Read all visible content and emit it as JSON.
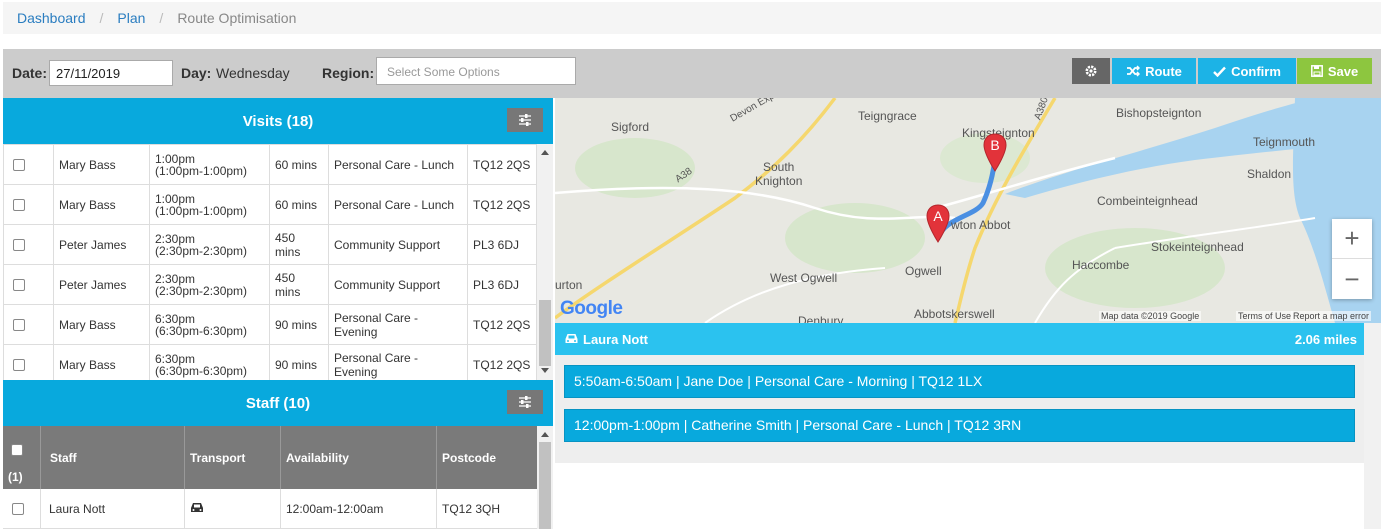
{
  "breadcrumb": {
    "items": [
      "Dashboard",
      "Plan"
    ],
    "current": "Route Optimisation",
    "separator": "/"
  },
  "filters": {
    "date_label": "Date:",
    "date_value": "27/11/2019",
    "day_label": "Day:",
    "day_value": "Wednesday",
    "region_label": "Region:",
    "region_placeholder": "Select Some Options"
  },
  "toolbar": {
    "route_label": "Route",
    "confirm_label": "Confirm",
    "save_label": "Save"
  },
  "visits": {
    "title": "Visits (18)",
    "rows": [
      {
        "name": "Mary Bass",
        "time": "1:00pm",
        "range": "(1:00pm-1:00pm)",
        "duration": "60 mins",
        "type": "Personal Care - Lunch",
        "postcode": "TQ12 2QS"
      },
      {
        "name": "Mary Bass",
        "time": "1:00pm",
        "range": "(1:00pm-1:00pm)",
        "duration": "60 mins",
        "type": "Personal Care - Lunch",
        "postcode": "TQ12 2QS"
      },
      {
        "name": "Peter James",
        "time": "2:30pm",
        "range": "(2:30pm-2:30pm)",
        "duration": "450 mins",
        "type": "Community Support",
        "postcode": "PL3 6DJ"
      },
      {
        "name": "Peter James",
        "time": "2:30pm",
        "range": "(2:30pm-2:30pm)",
        "duration": "450 mins",
        "type": "Community Support",
        "postcode": "PL3 6DJ"
      },
      {
        "name": "Mary Bass",
        "time": "6:30pm",
        "range": "(6:30pm-6:30pm)",
        "duration": "90 mins",
        "type": "Personal Care - Evening",
        "postcode": "TQ12 2QS"
      },
      {
        "name": "Mary Bass",
        "time": "6:30pm",
        "range": "(6:30pm-6:30pm)",
        "duration": "90 mins",
        "type": "Personal Care - Evening",
        "postcode": "TQ12 2QS"
      }
    ]
  },
  "staff": {
    "title": "Staff (10)",
    "selected_count": "(1)",
    "columns": {
      "staff": "Staff",
      "transport": "Transport",
      "availability": "Availability",
      "postcode": "Postcode"
    },
    "rows": [
      {
        "name": "Laura Nott",
        "transport_icon": "car-icon",
        "availability": "12:00am-12:00am",
        "postcode": "TQ12 3QH"
      }
    ]
  },
  "map": {
    "labels": {
      "sigford": "Sigford",
      "teigngrace": "Teigngrace",
      "kingsteignton": "Kingsteignton",
      "bishopsteignton": "Bishopsteignton",
      "teignmouth": "Teignmouth",
      "shaldon": "Shaldon",
      "south_knighton": "South\nKnighton",
      "newton_abbot": "wton Abbot",
      "combeinteignhead": "Combeinteignhead",
      "stokeinteignhead": "Stokeinteignhead",
      "haccombe": "Haccombe",
      "ogwell": "Ogwell",
      "west_ogwell": "West Ogwell",
      "abbotskerswell": "Abbotskerswell",
      "denbury": "Denbury",
      "urton": "urton",
      "a38": "A38",
      "a380": "A380",
      "devon_exp": "Devon Exp"
    },
    "marker_a": "A",
    "marker_b": "B",
    "google": "Google",
    "footer": [
      "Map data ©2019 Google",
      "Terms of Use",
      "Report a map error"
    ],
    "zoom_in": "+",
    "zoom_out": "−"
  },
  "route": {
    "staff_name": "Laura Nott",
    "distance": "2.06 miles",
    "stops": [
      "5:50am-6:50am | Jane Doe | Personal Care - Morning | TQ12 1LX",
      "12:00pm-1:00pm | Catherine Smith | Personal Care - Lunch | TQ12 3RN"
    ]
  },
  "colors": {
    "accent": "#08a9dd",
    "route_header": "#2bc2ef",
    "save": "#8dc63f",
    "marker": "#e2333a",
    "route_line": "#4a8fe2"
  }
}
